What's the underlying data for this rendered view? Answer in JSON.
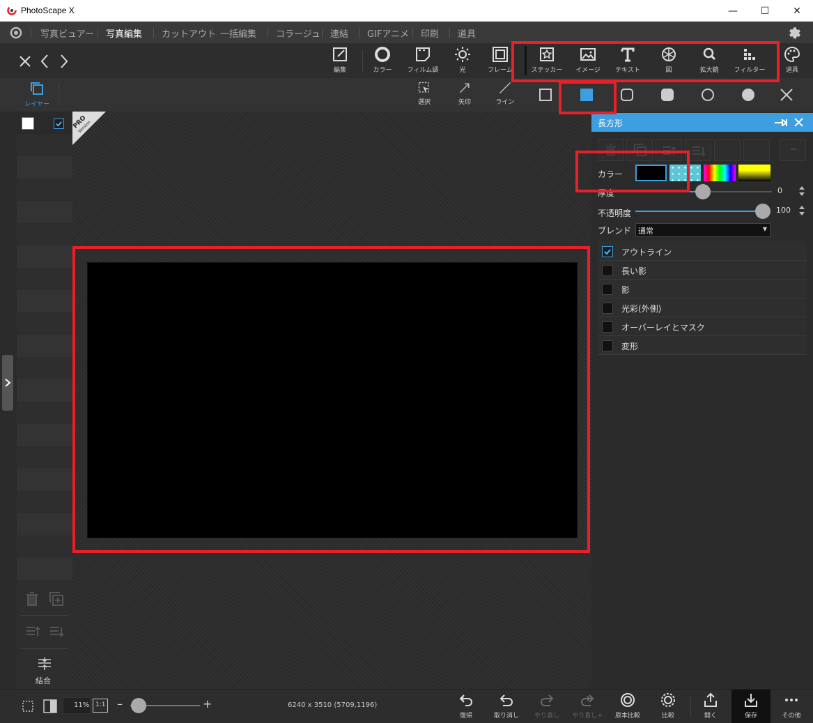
{
  "window": {
    "title": "PhotoScape X",
    "minimize": "—",
    "maximize": "☐",
    "close": "✕"
  },
  "menu": {
    "items": [
      "写真ビュアー",
      "写真編集",
      "カットアウト",
      "一括編集",
      "コラージュ",
      "連結",
      "GIFアニメ",
      "印刷",
      "道具"
    ],
    "active_index": 1
  },
  "toolbar": {
    "tools": [
      "編集",
      "カラー",
      "フィルム調",
      "光",
      "フレーム",
      "ステッカー",
      "イメージ",
      "テキスト",
      "図",
      "拡大鏡",
      "フィルター",
      "道具"
    ]
  },
  "subtoolbar": {
    "layer_label": "レイヤー",
    "tools": [
      "選択",
      "矢印",
      "ライン"
    ]
  },
  "left_panel": {
    "merge_label": "結合",
    "pro_badge": "PRO",
    "pro_badge_sub": "Version"
  },
  "right_panel": {
    "title": "長方形",
    "color_label": "カラー",
    "thickness_label": "厚度",
    "thickness_value": "0",
    "opacity_label": "不透明度",
    "opacity_value": "100",
    "blend_label": "ブレンド",
    "blend_value": "通常",
    "effects": [
      {
        "label": "アウトライン",
        "checked": true
      },
      {
        "label": "長い影",
        "checked": false
      },
      {
        "label": "影",
        "checked": false
      },
      {
        "label": "光彩(外側)",
        "checked": false
      },
      {
        "label": "オーバーレイとマスク",
        "checked": false
      },
      {
        "label": "変形",
        "checked": false
      }
    ]
  },
  "bottom_bar": {
    "zoom": "11%",
    "ratio": "1:1",
    "dimensions": "6240 x 3510 (5709,1196)",
    "tools": [
      "復帰",
      "取り消し",
      "やり直し",
      "やり直し+",
      "原本比較",
      "比較",
      "開く",
      "保存",
      "その他"
    ]
  },
  "colors": {
    "accent": "#3d9ee0",
    "highlight_red": "#e8202a",
    "shape_fill": "#000000"
  }
}
